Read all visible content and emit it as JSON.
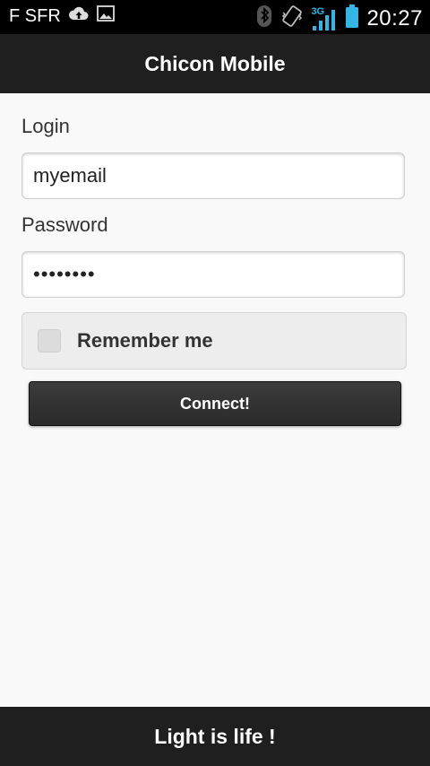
{
  "status_bar": {
    "carrier": "F SFR",
    "network_type": "3G",
    "time": "20:27",
    "icons": [
      "cloud-upload-icon",
      "image-icon",
      "bluetooth-icon",
      "vibrate-icon",
      "signal-icon",
      "battery-icon"
    ]
  },
  "header": {
    "title": "Chicon Mobile"
  },
  "form": {
    "login_label": "Login",
    "login_value": "myemail",
    "password_label": "Password",
    "password_value": "••••••••",
    "remember_label": "Remember me",
    "remember_checked": false,
    "connect_label": "Connect!"
  },
  "footer": {
    "text": "Light is life !"
  },
  "colors": {
    "header_bg": "#1f1f1f",
    "page_bg": "#f9f9f9",
    "status_bar_bg": "#000000",
    "network_accent": "#33b5e5"
  }
}
